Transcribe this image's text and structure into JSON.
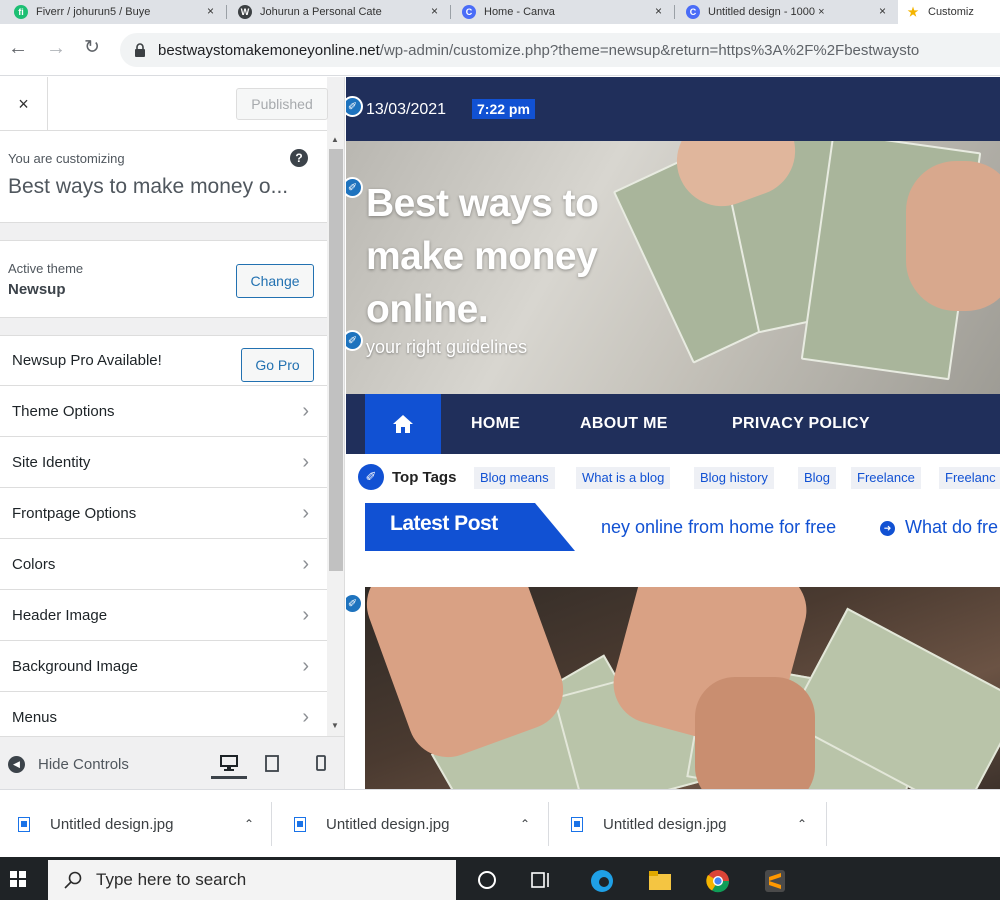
{
  "browser": {
    "tabs": [
      {
        "title": "Fiverr / johurun5 / Buye",
        "icon_color": "#1dbf73",
        "icon_letter": "fi"
      },
      {
        "title": "Johurun a Personal Cate",
        "icon_color": "#3c4043",
        "icon_letter": "W"
      },
      {
        "title": "Home - Canva",
        "icon_color": "#4a6cf7",
        "icon_letter": "C"
      },
      {
        "title": "Untitled design - 1000 ×",
        "icon_color": "#4a6cf7",
        "icon_letter": "C"
      },
      {
        "title": "Customiz",
        "icon_color": "#f4b400",
        "icon_letter": "★"
      }
    ],
    "tab_close": "×",
    "url_host": "bestwaystomakemoneyonline.net",
    "url_path": "/wp-admin/customize.php?theme=newsup&return=https%3A%2F%2Fbestwaysto"
  },
  "customizer": {
    "close": "×",
    "published": "Published",
    "customizing_label": "You are customizing",
    "site_title": "Best ways to make money o...",
    "help": "?",
    "active_theme_label": "Active theme",
    "theme_name": "Newsup",
    "change": "Change",
    "pro_label": "Newsup Pro Available!",
    "go_pro": "Go Pro",
    "sections": [
      "Theme Options",
      "Site Identity",
      "Frontpage Options",
      "Colors",
      "Header Image",
      "Background Image",
      "Menus"
    ],
    "hide_controls": "Hide Controls"
  },
  "site": {
    "date": "13/03/2021",
    "time": "7:22 pm",
    "title": "Best ways to make money online.",
    "tagline": "your right guidelines",
    "nav": [
      "HOME",
      "ABOUT ME",
      "PRIVACY POLICY"
    ],
    "top_tags_label": "Top Tags",
    "tags": [
      "Blog means",
      "What is a blog",
      "Blog history",
      "Blog",
      "Freelance",
      "Freelanc"
    ],
    "latest_post": "Latest Post",
    "ticker": [
      "ney online from home for free",
      "What do fre"
    ]
  },
  "downloads": [
    "Untitled design.jpg",
    "Untitled design.jpg",
    "Untitled design.jpg"
  ],
  "taskbar": {
    "search_placeholder": "Type here to search"
  },
  "colors": {
    "navy": "#202f5b",
    "accent_blue": "#1151d3",
    "wp_blue": "#2271b1"
  }
}
